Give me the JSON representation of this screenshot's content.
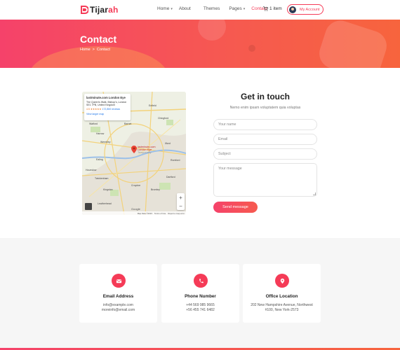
{
  "brand": {
    "name_first": "Tijar",
    "name_accent": "ah",
    "accent_color": "#f53b57"
  },
  "nav": {
    "items": [
      {
        "label": "Home",
        "has_dropdown": true
      },
      {
        "label": "About",
        "has_dropdown": false
      },
      {
        "label": "Themes",
        "has_dropdown": false
      },
      {
        "label": "Pages",
        "has_dropdown": true
      },
      {
        "label": "Contact",
        "has_dropdown": false,
        "active": true
      }
    ],
    "cart_label": "1 item",
    "account_label": "My Account"
  },
  "hero": {
    "title": "Contact",
    "breadcrumb": {
      "home": "Home",
      "separator": ">",
      "current": "Contact"
    }
  },
  "map": {
    "card_title": "lastminute.com London Eye",
    "card_address_1": "The Queen's Walk, Bishop's, London",
    "card_address_2": "SE1 7PB, United Kingdom",
    "card_rating": "4.5 ★★★★★",
    "card_reviews": "172,800 reviews",
    "card_link": "View larger map",
    "pin_label_1": "lastminute.com",
    "pin_label_2": "London Eye",
    "pin_label_3": "Temporarily",
    "zoom_in": "+",
    "zoom_out": "−",
    "google": "Google",
    "footer_1": "Map Data ©2023",
    "footer_2": "Terms of Use",
    "footer_3": "Report a map error",
    "places": [
      "Harrow",
      "Wembley",
      "Ealing",
      "Hounslow",
      "Twickenham",
      "Croydon",
      "Enfield",
      "Chingford",
      "Ilford",
      "Romford",
      "Dartford",
      "Bromley",
      "Leatherhead",
      "Kingston",
      "Barnet",
      "Watford"
    ]
  },
  "form": {
    "title": "Get in touch",
    "subtitle": "Nemo enim ipsam voluptatem quia voluptas",
    "name_placeholder": "Your name",
    "email_placeholder": "Email",
    "subject_placeholder": "Subject",
    "message_placeholder": "Your message",
    "submit_label": "Send message"
  },
  "info": {
    "cards": [
      {
        "title": "Email Address",
        "line1": "info@example.com",
        "line2": "moreinfo@email.com",
        "icon": "email-icon"
      },
      {
        "title": "Phone Number",
        "line1": "+44 569 985 9665",
        "line2": "+56 455 741 6482",
        "icon": "phone-icon"
      },
      {
        "title": "Office Location",
        "line1": "202 New Hampshire Avenue, Northwest",
        "line2": "#100, New York-2573",
        "icon": "location-icon"
      }
    ]
  }
}
